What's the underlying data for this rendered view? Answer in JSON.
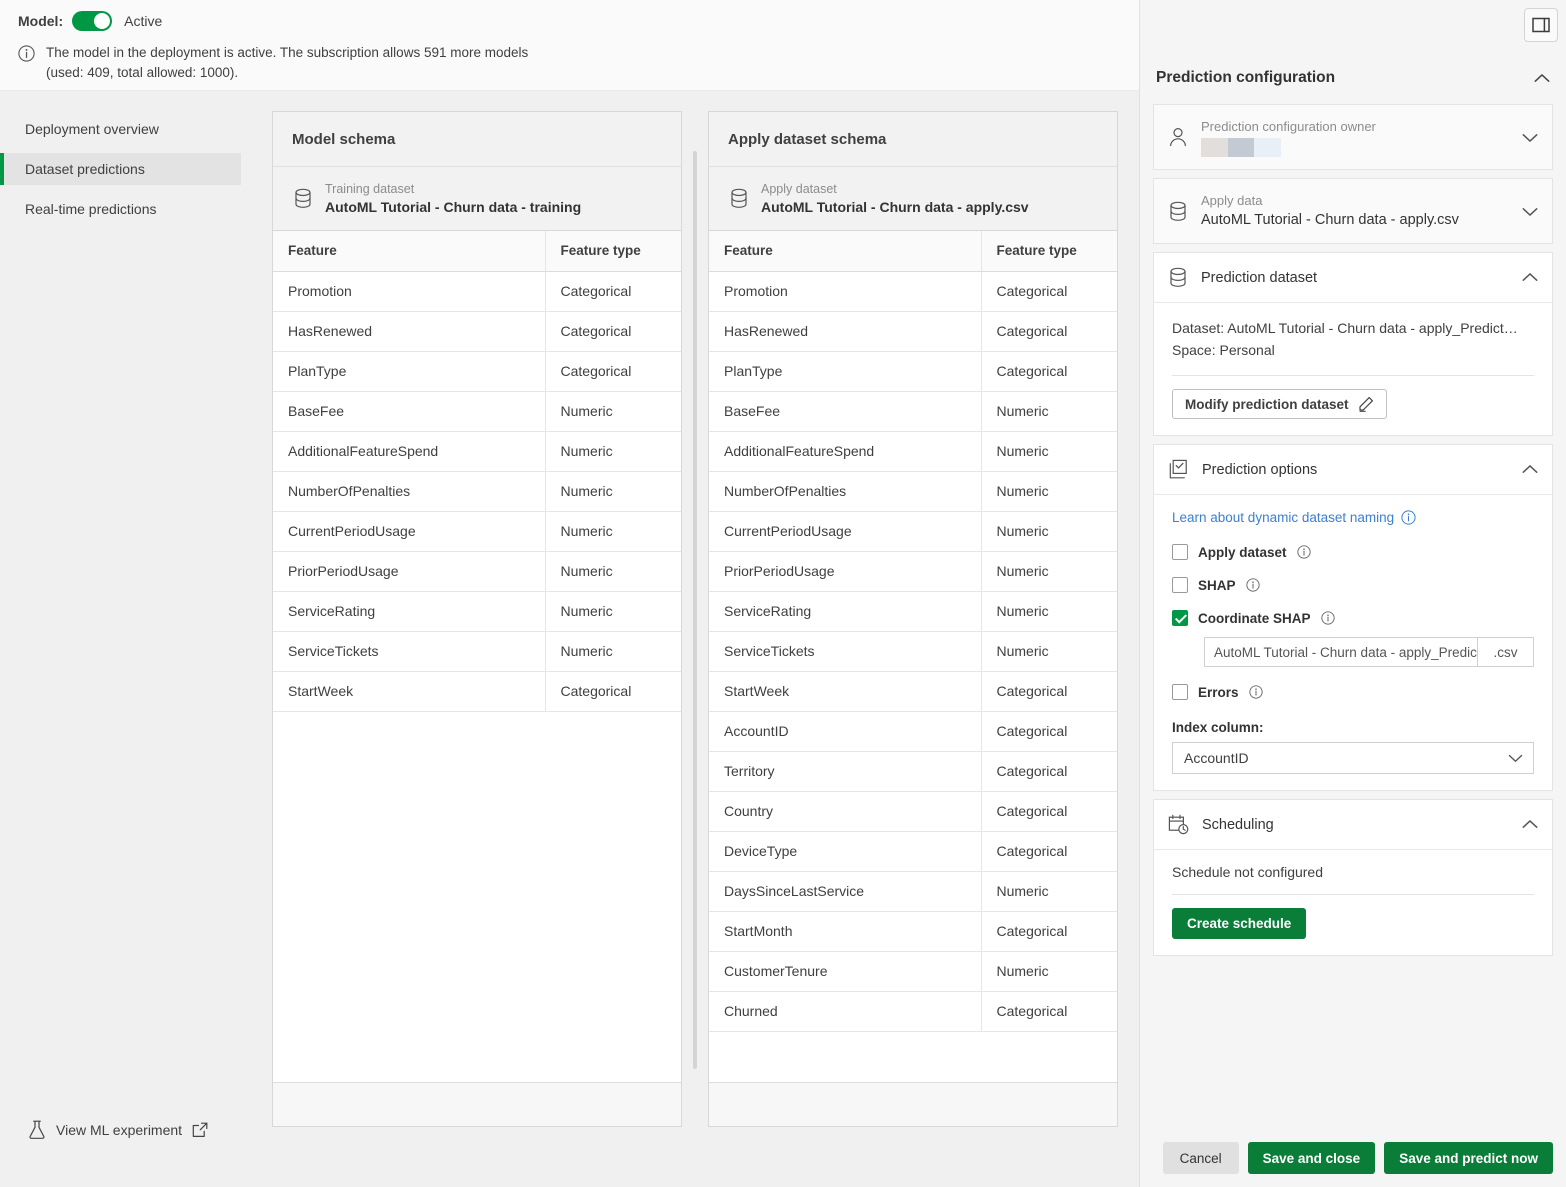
{
  "banner": {
    "model_label": "Model:",
    "toggle_state": "Active",
    "info_line1": "The model in the deployment is active. The subscription allows 591 more models",
    "info_line2": "(used: 409, total allowed: 1000).",
    "accent_green": "#009845"
  },
  "nav": {
    "items": [
      {
        "label": "Deployment overview",
        "active": false
      },
      {
        "label": "Dataset predictions",
        "active": true
      },
      {
        "label": "Real-time predictions",
        "active": false
      }
    ],
    "footer_label": "View ML experiment"
  },
  "model_schema": {
    "title": "Model schema",
    "dataset_kind": "Training dataset",
    "dataset_name": "AutoML Tutorial - Churn data - training",
    "columns": [
      "Feature",
      "Feature type"
    ],
    "rows": [
      [
        "Promotion",
        "Categorical"
      ],
      [
        "HasRenewed",
        "Categorical"
      ],
      [
        "PlanType",
        "Categorical"
      ],
      [
        "BaseFee",
        "Numeric"
      ],
      [
        "AdditionalFeatureSpend",
        "Numeric"
      ],
      [
        "NumberOfPenalties",
        "Numeric"
      ],
      [
        "CurrentPeriodUsage",
        "Numeric"
      ],
      [
        "PriorPeriodUsage",
        "Numeric"
      ],
      [
        "ServiceRating",
        "Numeric"
      ],
      [
        "ServiceTickets",
        "Numeric"
      ],
      [
        "StartWeek",
        "Categorical"
      ]
    ]
  },
  "apply_schema": {
    "title": "Apply dataset schema",
    "dataset_kind": "Apply dataset",
    "dataset_name": "AutoML Tutorial - Churn data - apply.csv",
    "columns": [
      "Feature",
      "Feature type"
    ],
    "rows": [
      [
        "Promotion",
        "Categorical"
      ],
      [
        "HasRenewed",
        "Categorical"
      ],
      [
        "PlanType",
        "Categorical"
      ],
      [
        "BaseFee",
        "Numeric"
      ],
      [
        "AdditionalFeatureSpend",
        "Numeric"
      ],
      [
        "NumberOfPenalties",
        "Numeric"
      ],
      [
        "CurrentPeriodUsage",
        "Numeric"
      ],
      [
        "PriorPeriodUsage",
        "Numeric"
      ],
      [
        "ServiceRating",
        "Numeric"
      ],
      [
        "ServiceTickets",
        "Numeric"
      ],
      [
        "StartWeek",
        "Categorical"
      ],
      [
        "AccountID",
        "Categorical"
      ],
      [
        "Territory",
        "Categorical"
      ],
      [
        "Country",
        "Categorical"
      ],
      [
        "DeviceType",
        "Categorical"
      ],
      [
        "DaysSinceLastService",
        "Numeric"
      ],
      [
        "StartMonth",
        "Categorical"
      ],
      [
        "CustomerTenure",
        "Numeric"
      ],
      [
        "Churned",
        "Categorical"
      ]
    ]
  },
  "right": {
    "title": "Prediction configuration",
    "owner": {
      "label": "Prediction configuration owner",
      "value_redacted": true,
      "redaction_colors": [
        "#e2dedb",
        "#c4cad4",
        "#e9eff7"
      ]
    },
    "apply_data": {
      "label": "Apply data",
      "value": "AutoML Tutorial - Churn data - apply.csv"
    },
    "prediction_dataset": {
      "title": "Prediction dataset",
      "dataset_line": "Dataset: AutoML Tutorial - Churn data - apply_Predict…",
      "space_line": "Space: Personal",
      "modify_button": "Modify prediction dataset"
    },
    "prediction_options": {
      "title": "Prediction options",
      "learn_link": "Learn about dynamic dataset naming",
      "checkboxes": [
        {
          "label": "Apply dataset",
          "checked": false
        },
        {
          "label": "SHAP",
          "checked": false
        },
        {
          "label": "Coordinate SHAP",
          "checked": true
        }
      ],
      "coordinate_shap_name": "AutoML Tutorial - Churn data - apply_Predictio",
      "coordinate_shap_ext": ".csv",
      "errors_checkbox": {
        "label": "Errors",
        "checked": false
      },
      "index_column_label": "Index column:",
      "index_column_value": "AccountID"
    },
    "scheduling": {
      "title": "Scheduling",
      "status": "Schedule not configured",
      "create_button": "Create schedule"
    }
  },
  "actions": {
    "cancel": "Cancel",
    "save_and_close": "Save and close",
    "save_and_predict": "Save and predict now"
  }
}
